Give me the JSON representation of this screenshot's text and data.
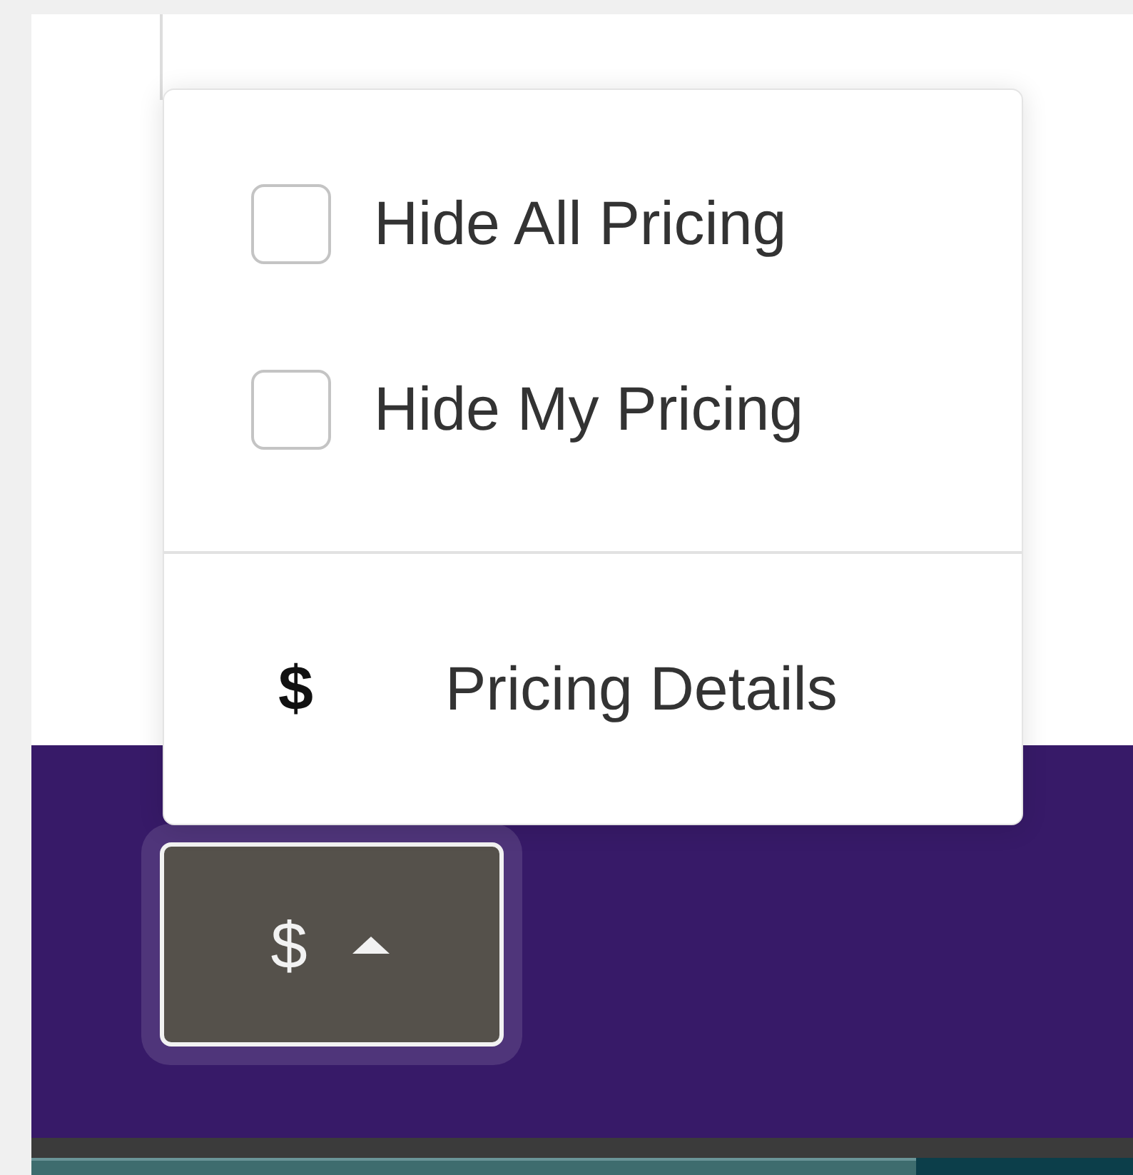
{
  "pricing_menu": {
    "options": [
      {
        "label": "Hide All Pricing",
        "checked": false
      },
      {
        "label": "Hide My Pricing",
        "checked": false
      }
    ],
    "details": {
      "icon": "$",
      "label": "Pricing Details"
    }
  },
  "pricing_button": {
    "icon": "$",
    "expanded": true
  }
}
